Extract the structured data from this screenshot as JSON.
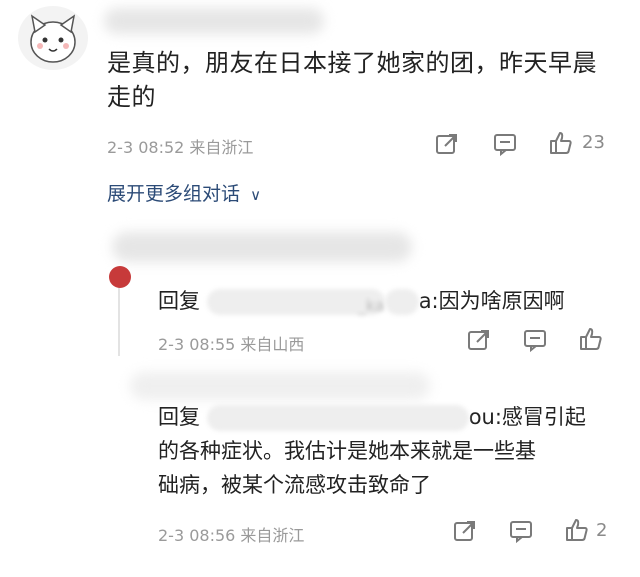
{
  "comment": {
    "text_line1": "是真的，朋友在日本接了她家的团，昨天早晨",
    "text_line2": "走的",
    "meta": "2-3 08:52 来自浙江",
    "likes": "23",
    "expand_label": "展开更多组对话"
  },
  "replies": [
    {
      "prefix": "回复",
      "mention_tail": "_ka",
      "mention_tail2": "a:",
      "text": "因为啥原因啊",
      "meta": "2-3 08:55 来自山西",
      "likes": ""
    },
    {
      "prefix": "回复",
      "mention_tail": "ou:",
      "text_line1": "感冒引起",
      "text_line2": "的各种症状。我估计是她本来就是一些基",
      "text_line3": "础病，被某个流感攻击致命了",
      "meta": "2-3 08:56 来自浙江",
      "likes": "2"
    }
  ]
}
